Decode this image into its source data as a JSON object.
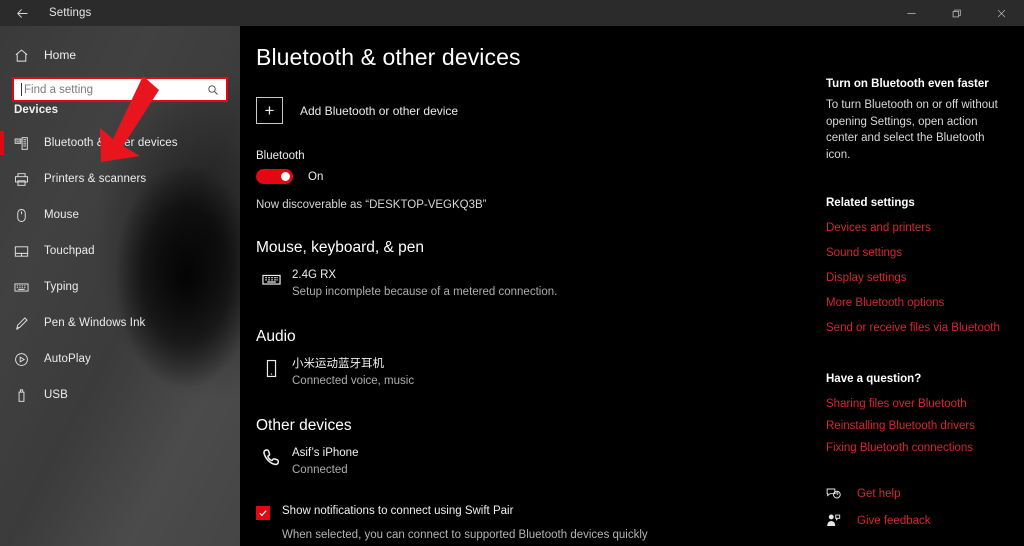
{
  "window": {
    "title": "Settings",
    "back_icon": "back-arrow-icon",
    "minimize_label": "–",
    "maximize_label": "❐",
    "close_label": "✕"
  },
  "sidebar": {
    "home_label": "Home",
    "home_icon": "home-icon",
    "search": {
      "placeholder": "Find a setting",
      "value": "",
      "icon": "search-icon"
    },
    "group_title": "Devices",
    "items": [
      {
        "label": "Bluetooth & other devices",
        "icon": "bluetooth-devices-icon",
        "selected": true
      },
      {
        "label": "Printers & scanners",
        "icon": "printer-icon",
        "selected": false
      },
      {
        "label": "Mouse",
        "icon": "mouse-icon",
        "selected": false
      },
      {
        "label": "Touchpad",
        "icon": "touchpad-icon",
        "selected": false
      },
      {
        "label": "Typing",
        "icon": "keyboard-icon",
        "selected": false
      },
      {
        "label": "Pen & Windows Ink",
        "icon": "pen-icon",
        "selected": false
      },
      {
        "label": "AutoPlay",
        "icon": "autoplay-icon",
        "selected": false
      },
      {
        "label": "USB",
        "icon": "usb-icon",
        "selected": false
      }
    ]
  },
  "main": {
    "page_title": "Bluetooth & other devices",
    "add_device": {
      "label": "Add Bluetooth or other device",
      "icon": "plus-icon"
    },
    "bluetooth": {
      "label": "Bluetooth",
      "state": "On",
      "discoverable": "Now discoverable as “DESKTOP-VEGKQ3B”"
    },
    "sections": [
      {
        "heading": "Mouse, keyboard, & pen",
        "devices": [
          {
            "name": "2.4G RX",
            "status": "Setup incomplete because of a metered connection.",
            "icon": "keyboard-icon"
          }
        ]
      },
      {
        "heading": "Audio",
        "devices": [
          {
            "name": "小米运动蓝牙耳机",
            "status": "Connected voice, music",
            "icon": "headset-device-icon"
          }
        ]
      },
      {
        "heading": "Other devices",
        "devices": [
          {
            "name": "Asif’s iPhone",
            "status": "Connected",
            "icon": "phone-handset-icon"
          }
        ]
      }
    ],
    "swift_pair": {
      "label": "Show notifications to connect using Swift Pair",
      "checked": true,
      "note": "When selected, you can connect to supported Bluetooth devices quickly"
    }
  },
  "rail": {
    "tip_title": "Turn on Bluetooth even faster",
    "tip_body": "To turn Bluetooth on or off without opening Settings, open action center and select the Bluetooth icon.",
    "related_title": "Related settings",
    "related_links": [
      "Devices and printers",
      "Sound settings",
      "Display settings",
      "More Bluetooth options",
      "Send or receive files via Bluetooth"
    ],
    "question_title": "Have a question?",
    "question_links": [
      "Sharing files over Bluetooth",
      "Reinstalling Bluetooth drivers",
      "Fixing Bluetooth connections"
    ],
    "footer": [
      {
        "label": "Get help",
        "icon": "help-bubble-icon"
      },
      {
        "label": "Give feedback",
        "icon": "feedback-icon"
      }
    ]
  },
  "annotation": {
    "arrow_color": "#e8151f",
    "highlight_color": "#e30613"
  }
}
